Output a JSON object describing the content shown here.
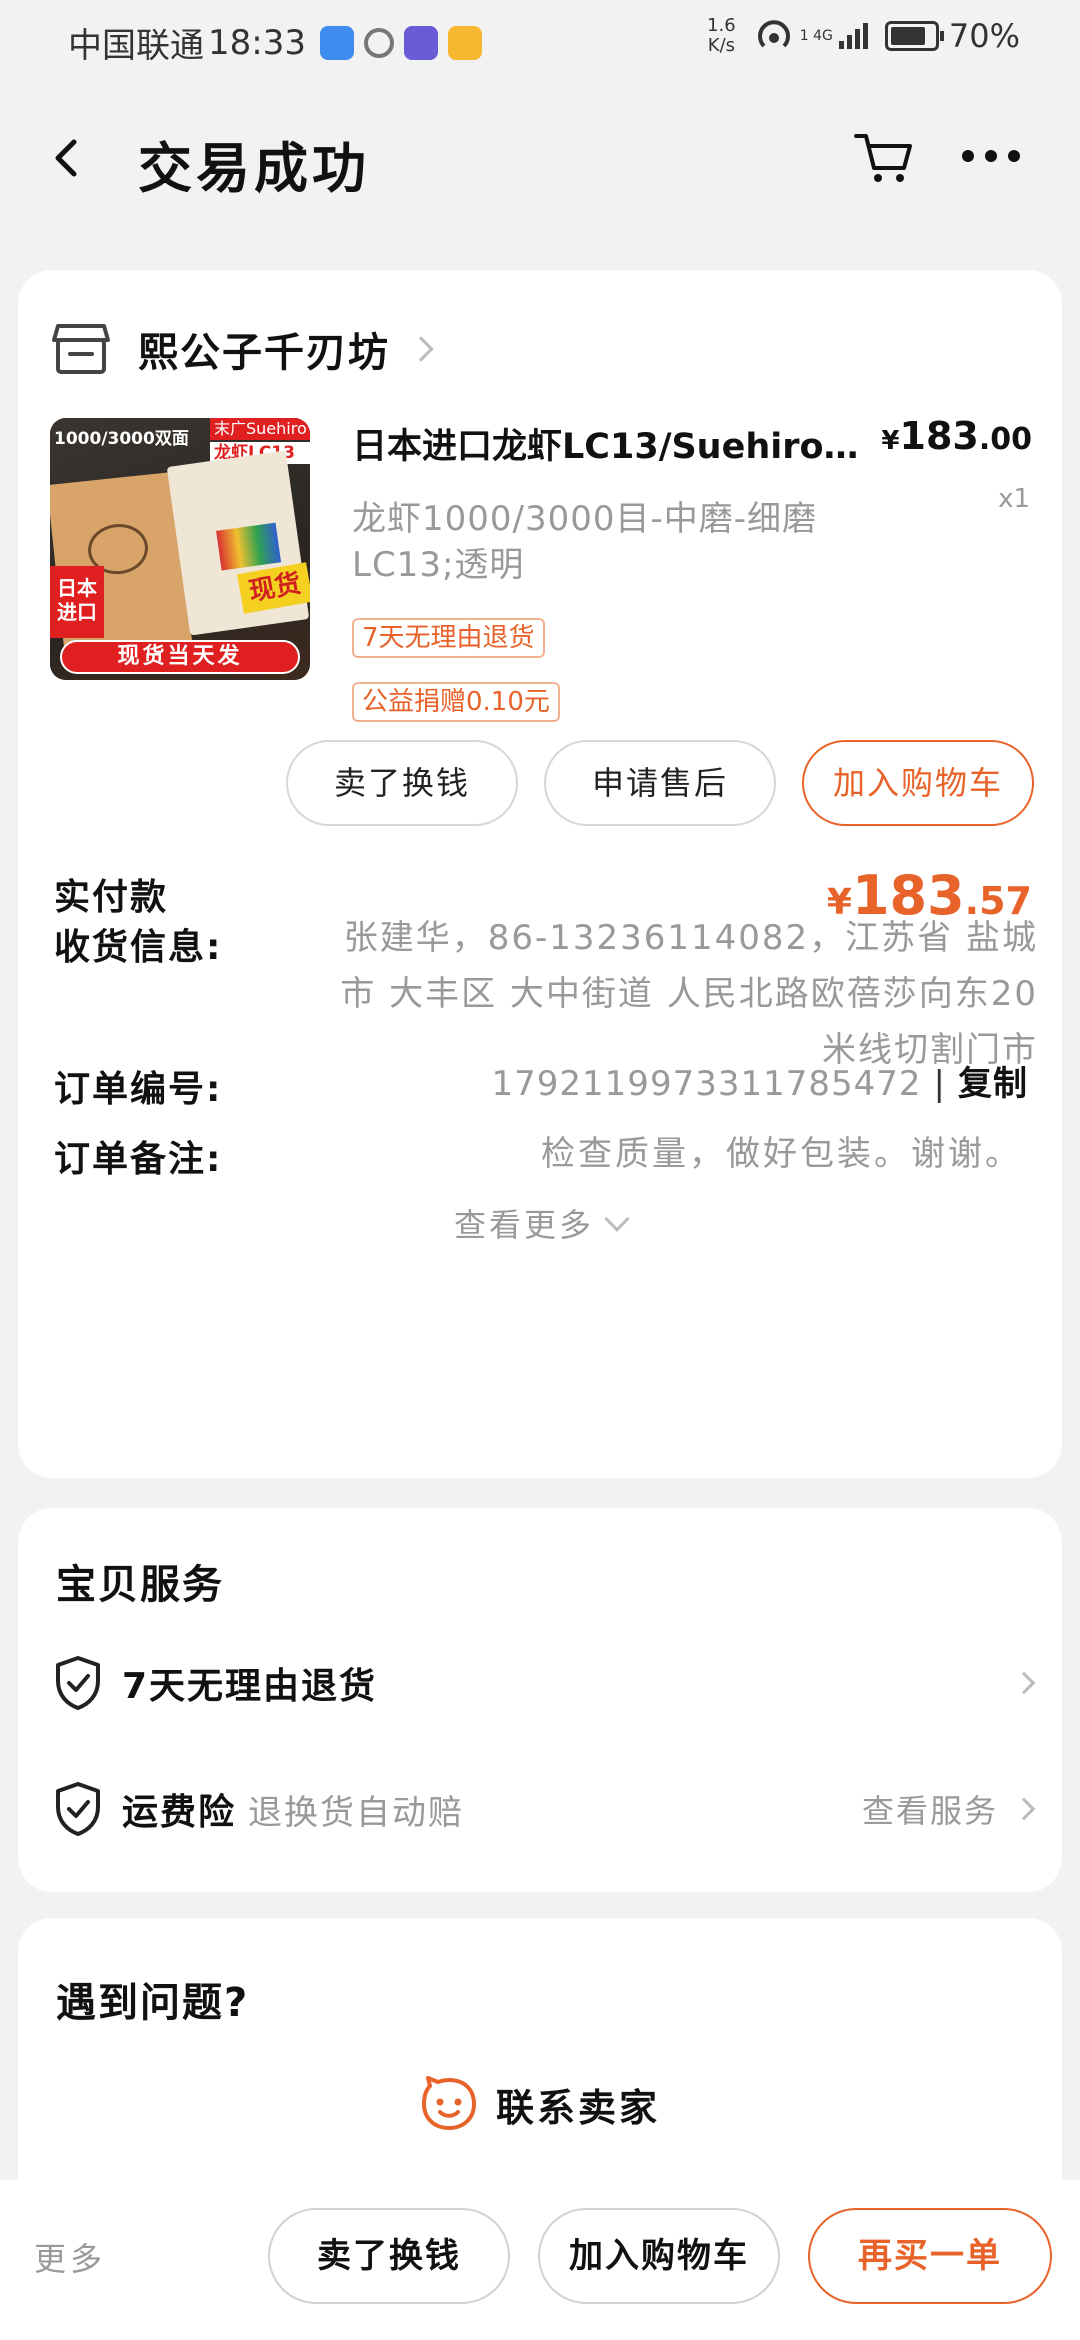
{
  "status_bar": {
    "carrier": "中国联通",
    "time": "18:33",
    "net_speed_value": "1.6",
    "net_speed_unit": "K/s",
    "signal_label": "1 4G",
    "battery": "70%"
  },
  "header": {
    "title": "交易成功"
  },
  "order_card": {
    "shop_name": "熙公子千刃坊",
    "product": {
      "thumb_texts": {
        "top_left": "1000/3000双面",
        "top_right": "末广Suehiro",
        "model": "龙虾LC13",
        "origin_line1": "日本",
        "origin_line2": "进口",
        "badge": "现货",
        "banner": "现货当天发"
      },
      "title": "日本进口龙虾LC13/Suehiro…",
      "price_symbol": "¥",
      "price_int": "183",
      "price_dec": ".00",
      "qty": "x1",
      "sku": "龙虾1000/3000目-中磨-细磨LC13;透明",
      "tags": [
        "7天无理由退货",
        "公益捐赠0.10元"
      ]
    },
    "actions": {
      "sell": "卖了换钱",
      "after_sale": "申请售后",
      "add_cart": "加入购物车"
    },
    "paid_label": "实付款",
    "paid_symbol": "¥",
    "paid_int": "183",
    "paid_dec": ".57",
    "address_label": "收货信息:",
    "address": "张建华，86-13236114082，江苏省 盐城市 大丰区 大中街道 人民北路欧蓓莎向东20米线切割门市",
    "order_no_label": "订单编号:",
    "order_no": "1792119973311785472",
    "order_sep": "|",
    "copy_label": "复制",
    "note_label": "订单备注:",
    "note": "检查质量，做好包装。谢谢。",
    "more_label": "查看更多"
  },
  "services": {
    "title": "宝贝服务",
    "items": [
      {
        "name": "7天无理由退货",
        "sub": "",
        "right": ""
      },
      {
        "name": "运费险",
        "sub": "退换货自动赔",
        "right": "查看服务"
      }
    ]
  },
  "problem": {
    "title": "遇到问题?",
    "contact": "联系卖家"
  },
  "bottom_bar": {
    "more": "更多",
    "sell": "卖了换钱",
    "add_cart": "加入购物车",
    "rebuy": "再买一单"
  },
  "colors": {
    "accent": "#e8632a",
    "page_bg": "#f2f2f2",
    "muted_text": "#999999"
  }
}
